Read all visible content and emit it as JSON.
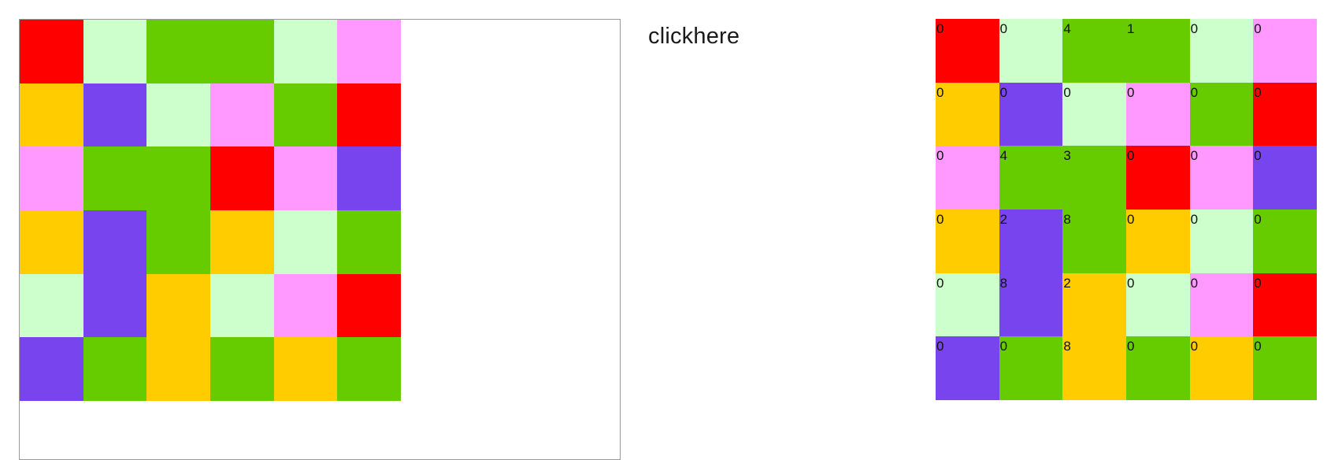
{
  "link": {
    "label": "clickhere"
  },
  "colors": {
    "R": "#ff0000",
    "L": "#ccffcc",
    "G": "#66cc00",
    "P": "#ff99ff",
    "Y": "#ffcc00",
    "V": "#7744ee"
  },
  "board": {
    "rows": [
      [
        "R",
        "L",
        "G",
        "G",
        "L",
        "P"
      ],
      [
        "Y",
        "V",
        "L",
        "P",
        "G",
        "R"
      ],
      [
        "P",
        "G",
        "G",
        "R",
        "P",
        "V"
      ],
      [
        "Y",
        "V",
        "G",
        "Y",
        "L",
        "G"
      ],
      [
        "L",
        "V",
        "Y",
        "L",
        "P",
        "R"
      ],
      [
        "V",
        "G",
        "Y",
        "G",
        "Y",
        "G"
      ]
    ]
  },
  "numbers_board": {
    "rows": [
      [
        {
          "c": "R",
          "n": "0"
        },
        {
          "c": "L",
          "n": "0"
        },
        {
          "c": "G",
          "n": "4"
        },
        {
          "c": "G",
          "n": "1"
        },
        {
          "c": "L",
          "n": "0"
        },
        {
          "c": "P",
          "n": "0"
        }
      ],
      [
        {
          "c": "Y",
          "n": "0"
        },
        {
          "c": "V",
          "n": "0"
        },
        {
          "c": "L",
          "n": "0"
        },
        {
          "c": "P",
          "n": "0"
        },
        {
          "c": "G",
          "n": "0"
        },
        {
          "c": "R",
          "n": "0"
        }
      ],
      [
        {
          "c": "P",
          "n": "0"
        },
        {
          "c": "G",
          "n": "4"
        },
        {
          "c": "G",
          "n": "3"
        },
        {
          "c": "R",
          "n": "0"
        },
        {
          "c": "P",
          "n": "0"
        },
        {
          "c": "V",
          "n": "0"
        }
      ],
      [
        {
          "c": "Y",
          "n": "0"
        },
        {
          "c": "V",
          "n": "2"
        },
        {
          "c": "G",
          "n": "8"
        },
        {
          "c": "Y",
          "n": "0"
        },
        {
          "c": "L",
          "n": "0"
        },
        {
          "c": "G",
          "n": "0"
        }
      ],
      [
        {
          "c": "L",
          "n": "0"
        },
        {
          "c": "V",
          "n": "8"
        },
        {
          "c": "Y",
          "n": "2"
        },
        {
          "c": "L",
          "n": "0"
        },
        {
          "c": "P",
          "n": "0"
        },
        {
          "c": "R",
          "n": "0"
        }
      ],
      [
        {
          "c": "V",
          "n": "0"
        },
        {
          "c": "G",
          "n": "0"
        },
        {
          "c": "Y",
          "n": "8"
        },
        {
          "c": "G",
          "n": "0"
        },
        {
          "c": "Y",
          "n": "0"
        },
        {
          "c": "G",
          "n": "0"
        }
      ]
    ]
  }
}
